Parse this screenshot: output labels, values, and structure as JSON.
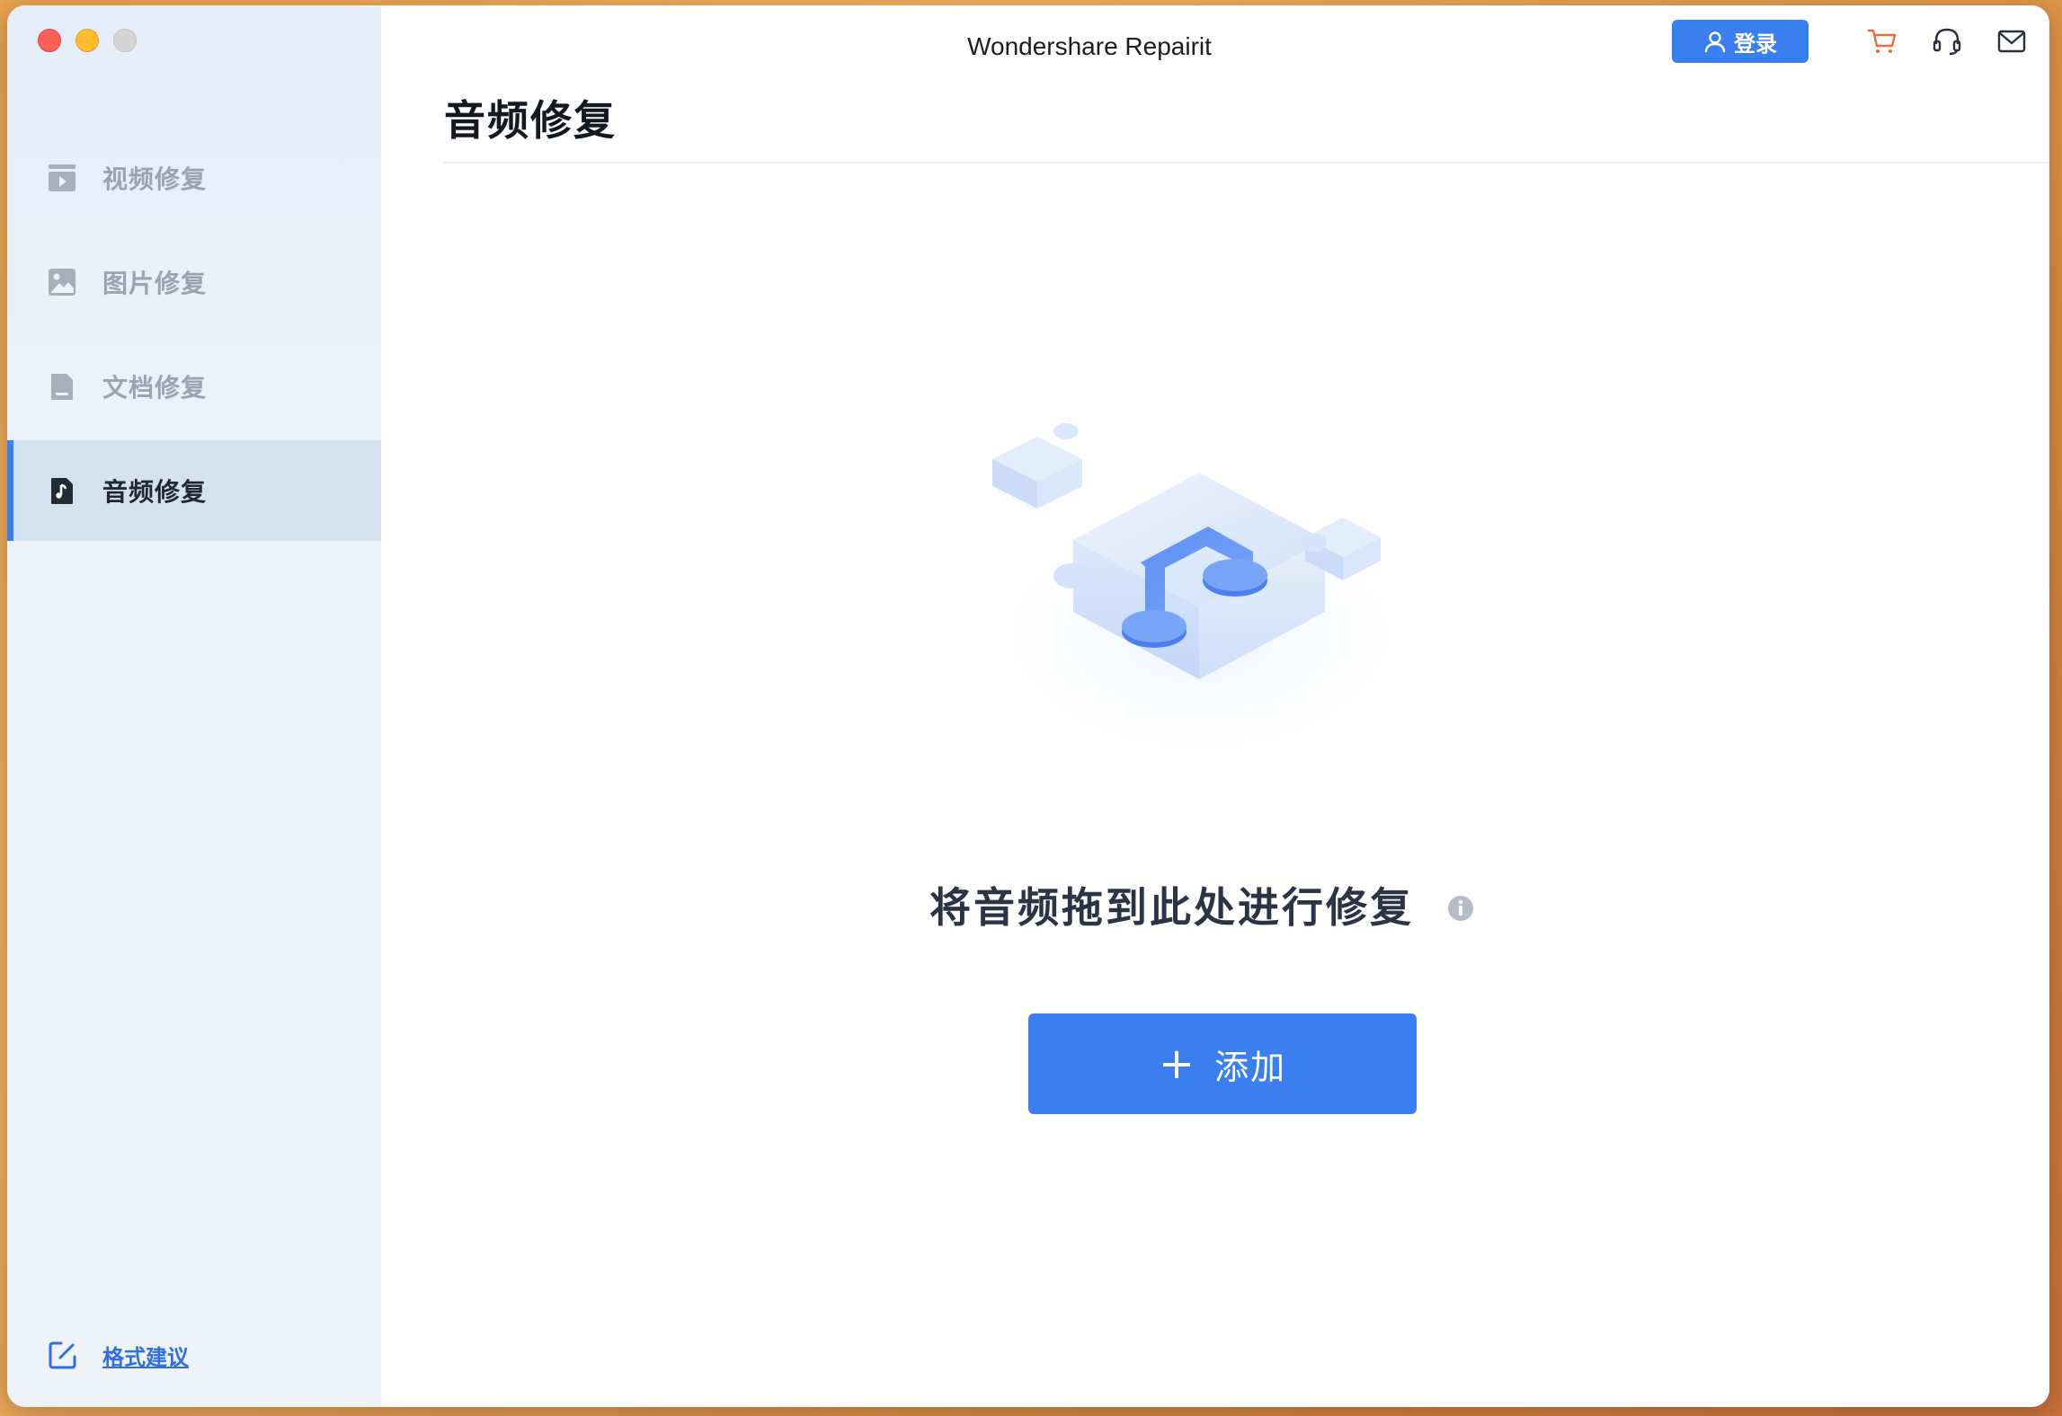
{
  "window": {
    "app_title": "Wondershare Repairit"
  },
  "header": {
    "login_label": "登录",
    "icons": [
      "user-icon",
      "cart-icon",
      "headset-icon",
      "mail-icon"
    ]
  },
  "sidebar": {
    "items": [
      {
        "label": "视频修复",
        "icon": "video-icon",
        "active": false
      },
      {
        "label": "图片修复",
        "icon": "image-icon",
        "active": false
      },
      {
        "label": "文档修复",
        "icon": "document-icon",
        "active": false
      },
      {
        "label": "音频修复",
        "icon": "audio-file-icon",
        "active": true
      }
    ],
    "feedback_label": "格式建议"
  },
  "main": {
    "page_title": "音频修复",
    "drop_text": "将音频拖到此处进行修复",
    "add_button_label": "添加",
    "add_button_symbol": "+"
  },
  "colors": {
    "accent": "#3a7ff0",
    "sidebar_active_bg": "#d3e1f1",
    "cart_icon": "#f06a3c"
  }
}
